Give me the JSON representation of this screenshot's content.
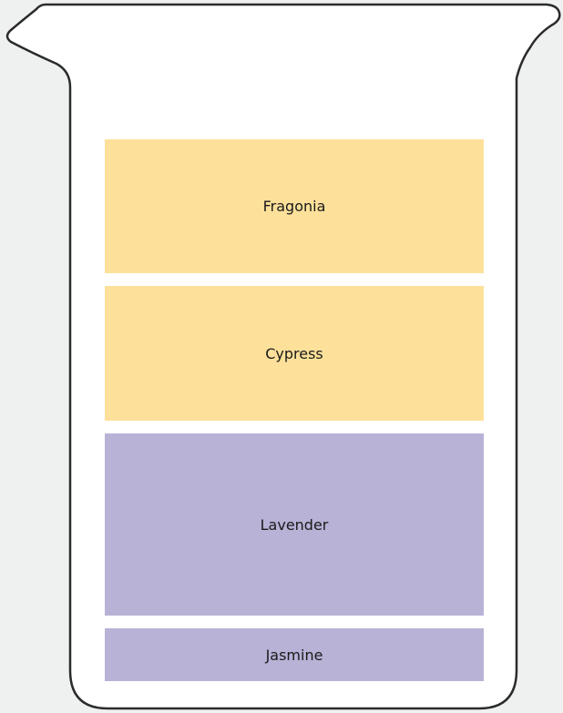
{
  "layers": [
    {
      "label": "Fragonia",
      "color": "#fde19a"
    },
    {
      "label": "Cypress",
      "color": "#fde19a"
    },
    {
      "label": "Lavender",
      "color": "#b7b2d6"
    },
    {
      "label": "Jasmine",
      "color": "#b7b2d6"
    }
  ],
  "colors": {
    "background": "#eef1f0",
    "beaker_fill": "#ffffff",
    "beaker_stroke": "#2b2b2b"
  }
}
